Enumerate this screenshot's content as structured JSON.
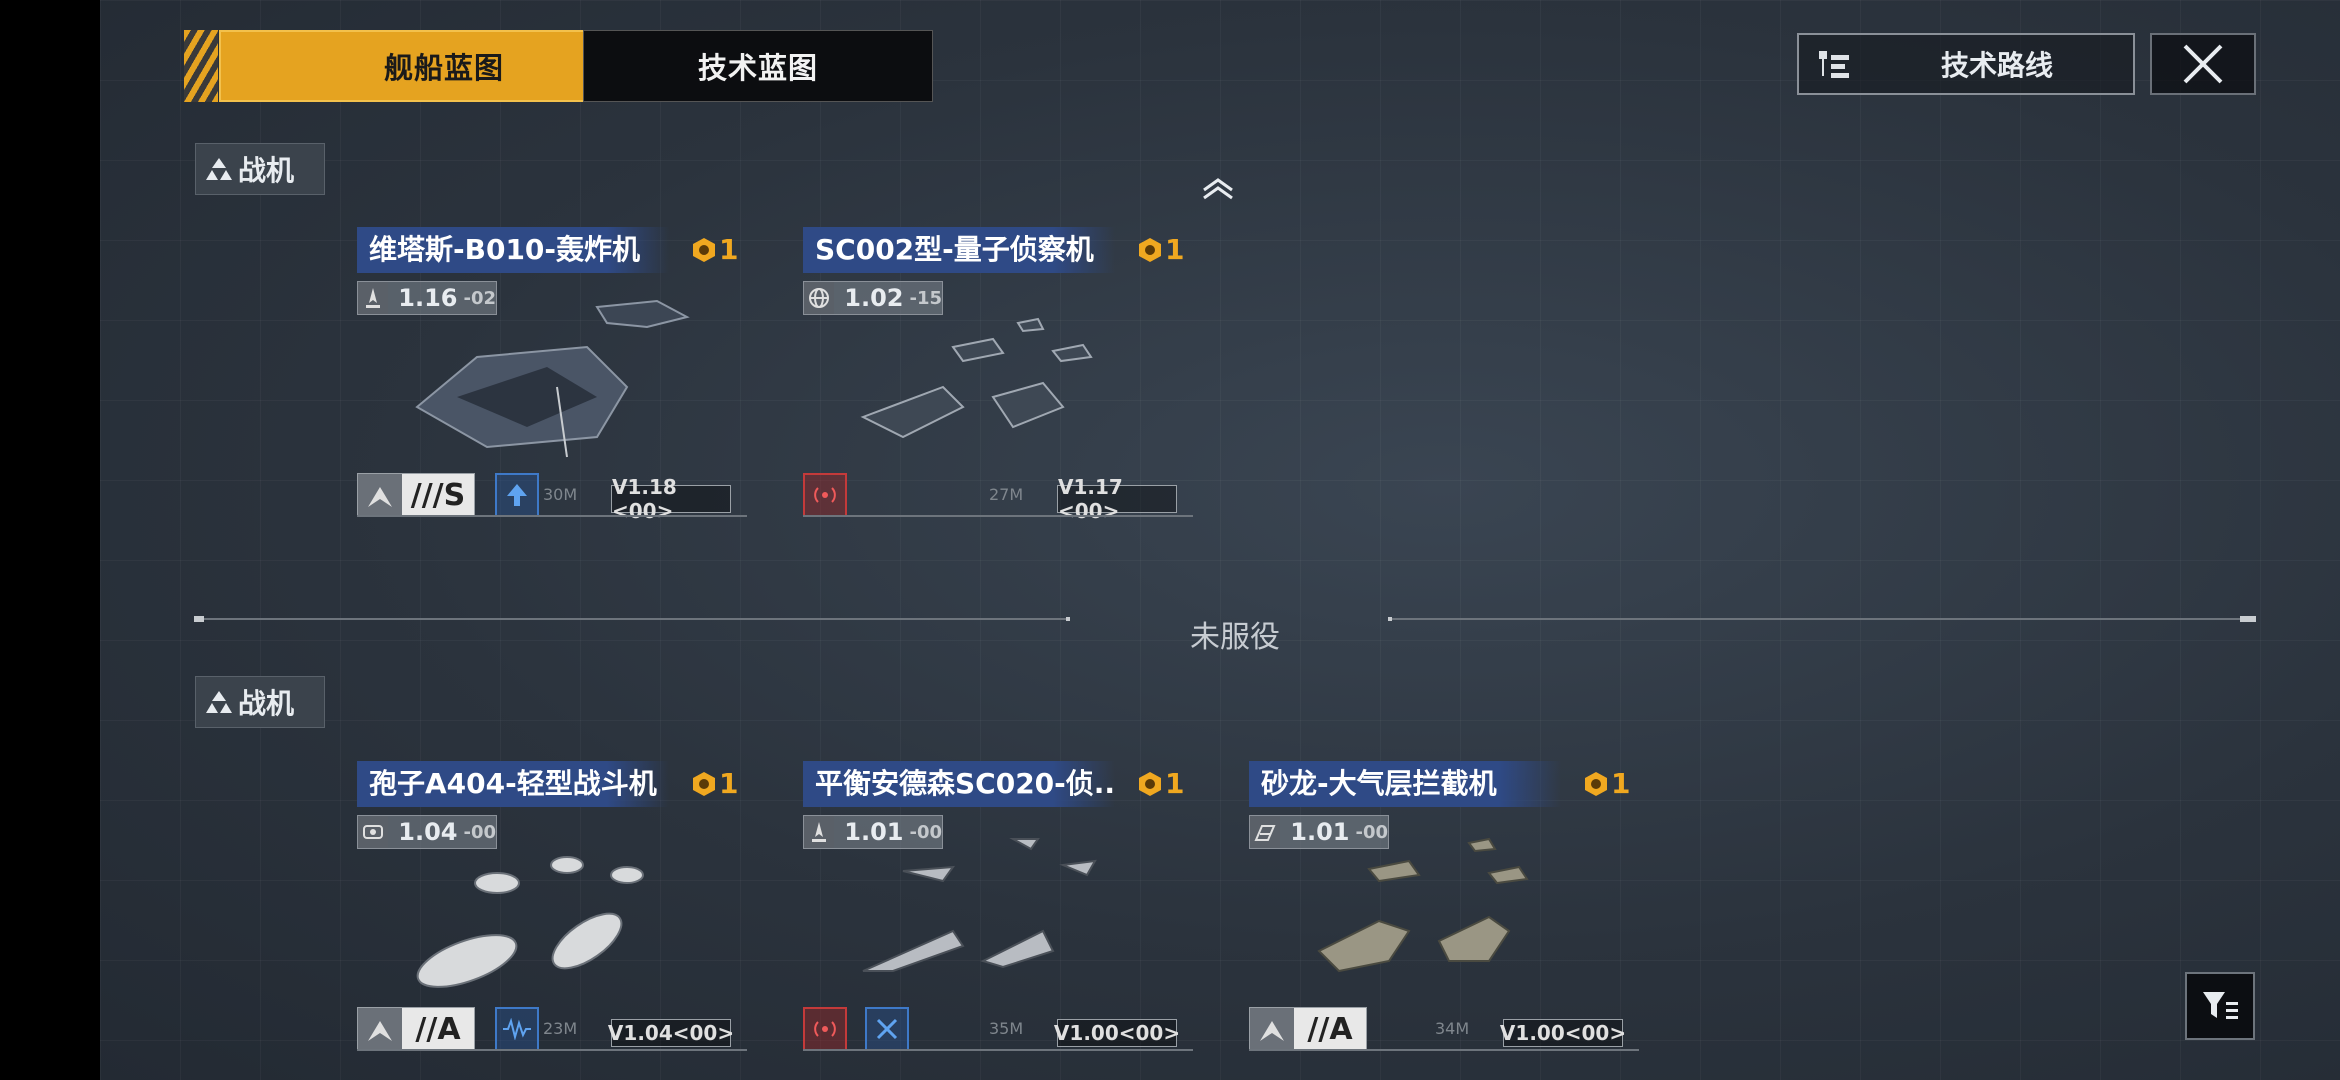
{
  "tabs": {
    "ship_blueprint": "舰船蓝图",
    "tech_blueprint": "技术蓝图"
  },
  "header": {
    "tech_route": "技术路线"
  },
  "sections": [
    {
      "label": "战机",
      "cards": [
        {
          "name": "维塔斯-B010-轰炸机",
          "badge": "1",
          "version": "1.16",
          "version_minor": "-02",
          "grade": "///S",
          "vcode": "V1.18 <00>",
          "distance": "30M",
          "skills": [
            "blue-arrow"
          ]
        },
        {
          "name": "SC002型-量子侦察机",
          "badge": "1",
          "version": "1.02",
          "version_minor": "-15",
          "grade": "",
          "vcode": "V1.17 <00>",
          "distance": "27M",
          "skills": [
            "red-signal"
          ]
        }
      ]
    },
    {
      "label": "战机",
      "cards": [
        {
          "name": "孢子A404-轻型战斗机",
          "badge": "1",
          "version": "1.04",
          "version_minor": "-00",
          "grade": "//A",
          "vcode": "V1.04<00>",
          "distance": "23M",
          "skills": [
            "blue-wave"
          ]
        },
        {
          "name": "平衡安德森SC020-侦...",
          "badge": "1",
          "version": "1.01",
          "version_minor": "-00",
          "grade": "",
          "vcode": "V1.00<00>",
          "distance": "35M",
          "skills": [
            "red-signal",
            "blue-cross"
          ]
        },
        {
          "name": "砂龙-大气层拦截机",
          "badge": "1",
          "version": "1.01",
          "version_minor": "-00",
          "grade": "//A",
          "vcode": "V1.00<00>",
          "distance": "34M",
          "skills": []
        }
      ]
    }
  ],
  "divider": {
    "label": "未服役"
  },
  "colors": {
    "accent": "#e5a320",
    "title_bar": "#2f4a86",
    "badge": "#f0a820",
    "skill_red": "#c43a3a",
    "skill_blue": "#3e79c8"
  },
  "icons": {
    "close": "close-icon",
    "filter": "filter-icon",
    "route": "tech-tree-icon",
    "scroll": "chevron-up-icon"
  }
}
